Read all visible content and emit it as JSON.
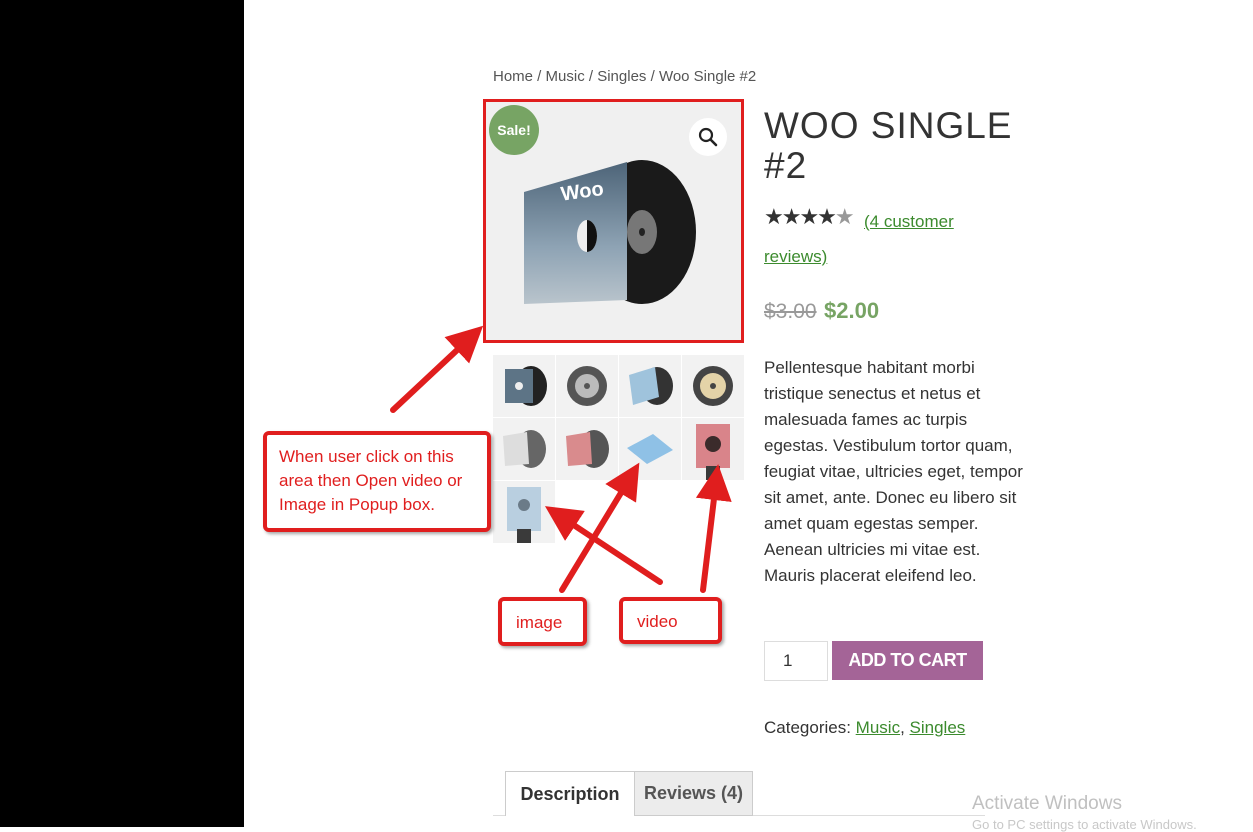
{
  "breadcrumb": {
    "home": "Home",
    "sep": " / ",
    "cat1": "Music",
    "cat2": "Singles",
    "current": "Woo Single #2"
  },
  "gallery": {
    "sale_label": "Sale!",
    "zoom_icon": "magnifier-icon"
  },
  "product": {
    "title": "WOO SINGLE #2",
    "reviews_link": "(4 customer reviews)",
    "price_old": "$3.00",
    "price_new": "$2.00",
    "description": "Pellentesque habitant morbi tristique senectus et netus et malesuada fames ac turpis egestas. Vestibulum tortor quam, feugiat vitae, ultricies eget, tempor sit amet, ante. Donec eu libero sit amet quam egestas semper. Aenean ultricies mi vitae est. Mauris placerat eleifend leo.",
    "quantity": "1",
    "add_to_cart": "ADD TO CART",
    "categories_label": "Categories:",
    "category_1": "Music",
    "category_2": "Singles"
  },
  "tabs": {
    "description": "Description",
    "reviews": "Reviews (4)"
  },
  "annotations": {
    "main": "When user click on this area then Open video or Image in Popup box.",
    "image": "image",
    "video": "video"
  },
  "watermark": {
    "line1": "Activate Windows",
    "line2": "Go to PC settings to activate Windows."
  },
  "colors": {
    "sale_green": "#77a464",
    "cart_purple": "#a46497",
    "annotation_red": "#e01e1e",
    "link_green": "#3c8b2e"
  }
}
